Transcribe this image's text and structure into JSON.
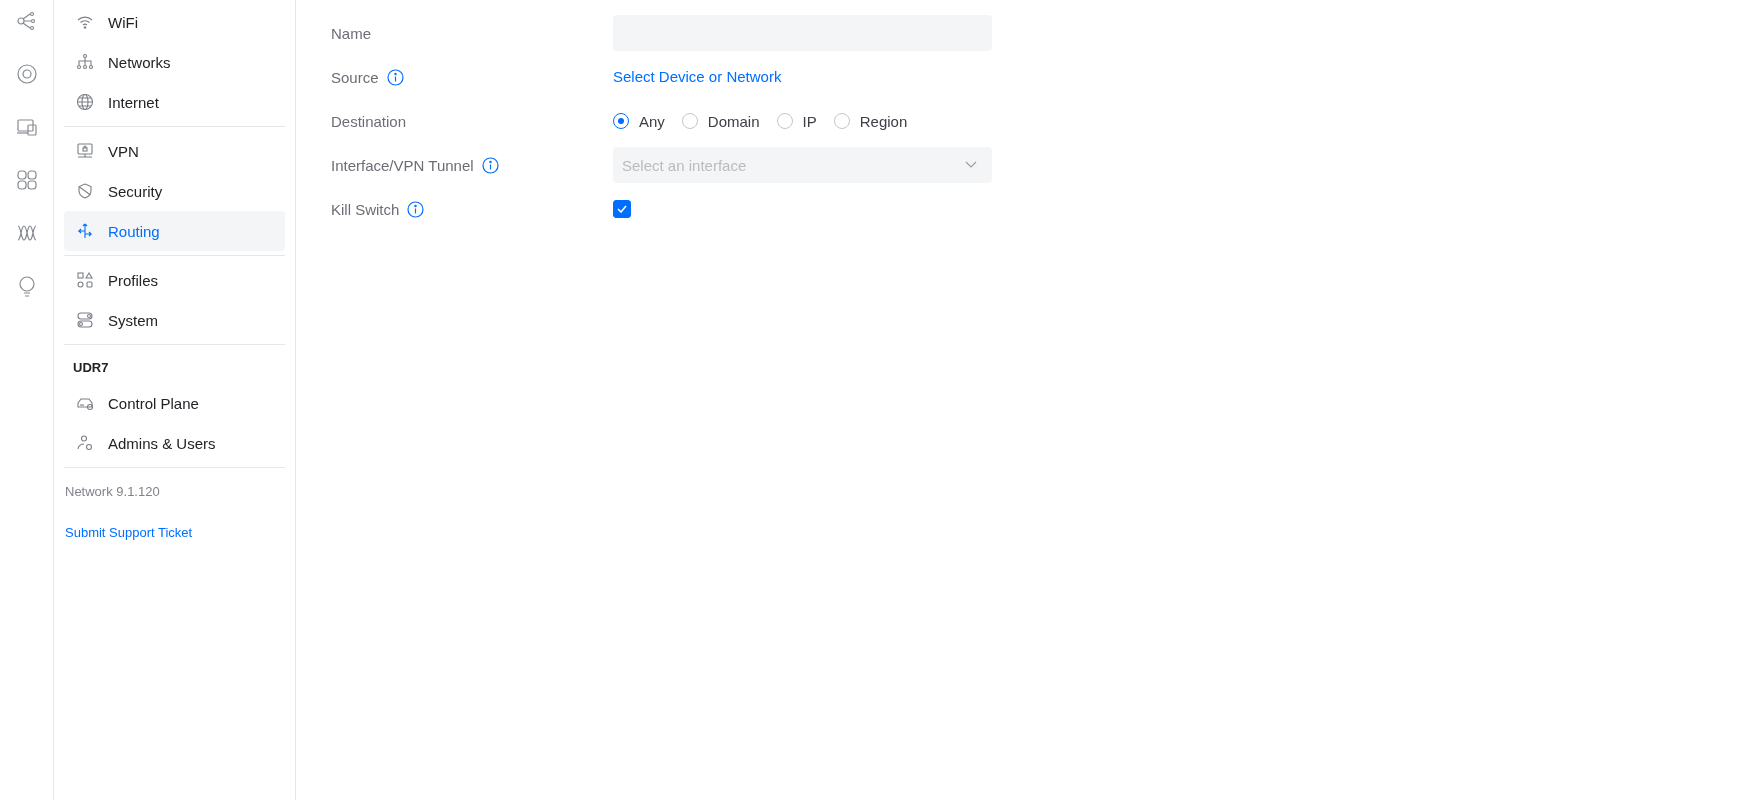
{
  "sidebar": {
    "sections": [
      {
        "items": [
          {
            "label": "WiFi",
            "selected": false
          },
          {
            "label": "Networks",
            "selected": false
          },
          {
            "label": "Internet",
            "selected": false
          }
        ]
      },
      {
        "items": [
          {
            "label": "VPN",
            "selected": false
          },
          {
            "label": "Security",
            "selected": false
          },
          {
            "label": "Routing",
            "selected": true
          }
        ]
      },
      {
        "items": [
          {
            "label": "Profiles",
            "selected": false
          },
          {
            "label": "System",
            "selected": false
          }
        ]
      },
      {
        "heading": "UDR7",
        "items": [
          {
            "label": "Control Plane",
            "selected": false
          },
          {
            "label": "Admins & Users",
            "selected": false
          }
        ]
      }
    ],
    "version": "Network 9.1.120",
    "support_link": "Submit Support Ticket"
  },
  "form": {
    "rows": [
      {
        "label": "Name",
        "info": false,
        "kind": "text"
      },
      {
        "label": "Source",
        "info": true,
        "kind": "link",
        "link": "Select Device or Network"
      },
      {
        "label": "Destination",
        "info": false,
        "kind": "radio",
        "options": [
          {
            "label": "Any",
            "selected": true
          },
          {
            "label": "Domain",
            "selected": false
          },
          {
            "label": "IP",
            "selected": false
          },
          {
            "label": "Region",
            "selected": false
          }
        ]
      },
      {
        "label": "Interface/VPN Tunnel",
        "info": true,
        "kind": "select",
        "placeholder": "Select an interface"
      },
      {
        "label": "Kill Switch",
        "info": true,
        "kind": "checkbox",
        "checked": true
      }
    ]
  }
}
